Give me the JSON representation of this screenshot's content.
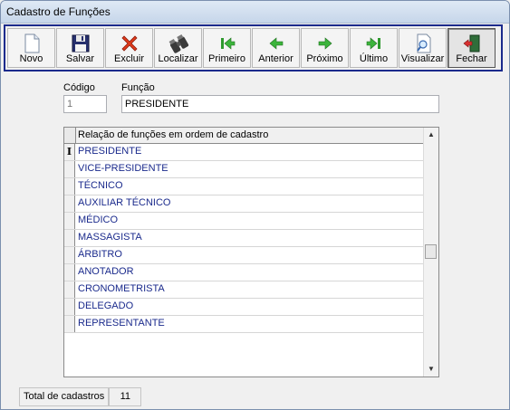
{
  "window": {
    "title": "Cadastro de Funções"
  },
  "toolbar": {
    "buttons": [
      {
        "label": "Novo",
        "icon": "new-document-icon"
      },
      {
        "label": "Salvar",
        "icon": "floppy-disk-icon"
      },
      {
        "label": "Excluir",
        "icon": "red-x-icon"
      },
      {
        "label": "Localizar",
        "icon": "binoculars-icon"
      },
      {
        "label": "Primeiro",
        "icon": "first-record-icon"
      },
      {
        "label": "Anterior",
        "icon": "previous-arrow-icon"
      },
      {
        "label": "Próximo",
        "icon": "next-arrow-icon"
      },
      {
        "label": "Último",
        "icon": "last-record-icon"
      },
      {
        "label": "Visualizar",
        "icon": "magnifier-document-icon"
      },
      {
        "label": "Fechar",
        "icon": "exit-door-icon"
      }
    ]
  },
  "form": {
    "codigo_label": "Código",
    "codigo_value": "1",
    "funcao_label": "Função",
    "funcao_value": "PRESIDENTE"
  },
  "grid": {
    "header": "Relação de funções em ordem de cadastro",
    "selected_indicator": "I",
    "rows": [
      "PRESIDENTE",
      "VICE-PRESIDENTE",
      "TÉCNICO",
      "AUXILIAR TÉCNICO",
      "MÉDICO",
      "MASSAGISTA",
      "ÁRBITRO",
      "ANOTADOR",
      "CRONOMETRISTA",
      "DELEGADO",
      "REPRESENTANTE"
    ]
  },
  "status": {
    "total_label": "Total de cadastros",
    "total_value": "11"
  },
  "colors": {
    "toolbar_border": "#1b2a8c",
    "grid_text": "#1a2a8c"
  }
}
